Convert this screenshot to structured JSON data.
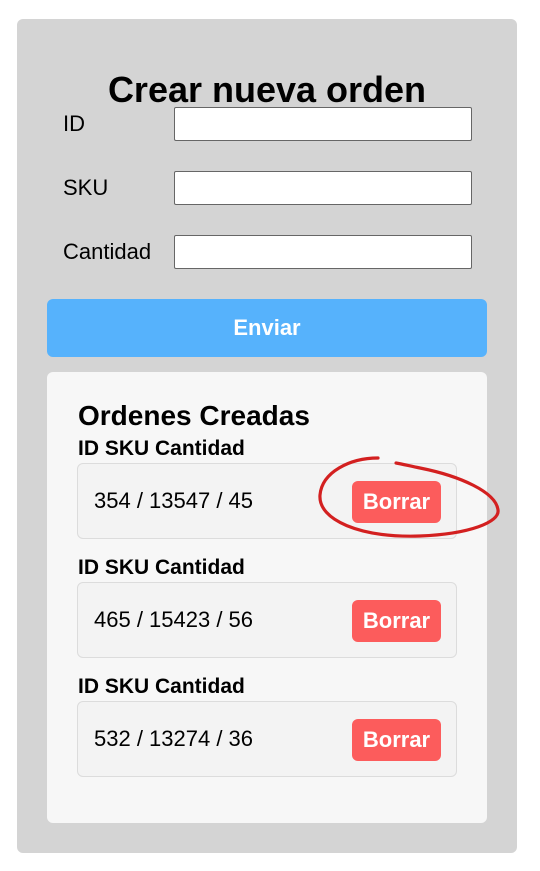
{
  "form": {
    "title": "Crear nueva orden",
    "fields": [
      {
        "label": "ID",
        "value": "",
        "placeholder": ""
      },
      {
        "label": "SKU",
        "value": "",
        "placeholder": ""
      },
      {
        "label": "Cantidad",
        "value": "",
        "placeholder": ""
      }
    ],
    "submit_label": "Enviar"
  },
  "orders": {
    "title": "Ordenes Creadas",
    "items": [
      {
        "header": "ID SKU Cantidad",
        "summary": "354 / 13547 / 45",
        "delete_label": "Borrar"
      },
      {
        "header": "ID SKU Cantidad",
        "summary": "465 / 15423 / 56",
        "delete_label": "Borrar"
      },
      {
        "header": "ID SKU Cantidad",
        "summary": "532 / 13274 / 36",
        "delete_label": "Borrar"
      }
    ]
  },
  "colors": {
    "outer_panel": "#d4d4d4",
    "submit_button": "#56b2fc",
    "delete_button": "#fc5c5c",
    "annotation_circle": "#d32020"
  }
}
